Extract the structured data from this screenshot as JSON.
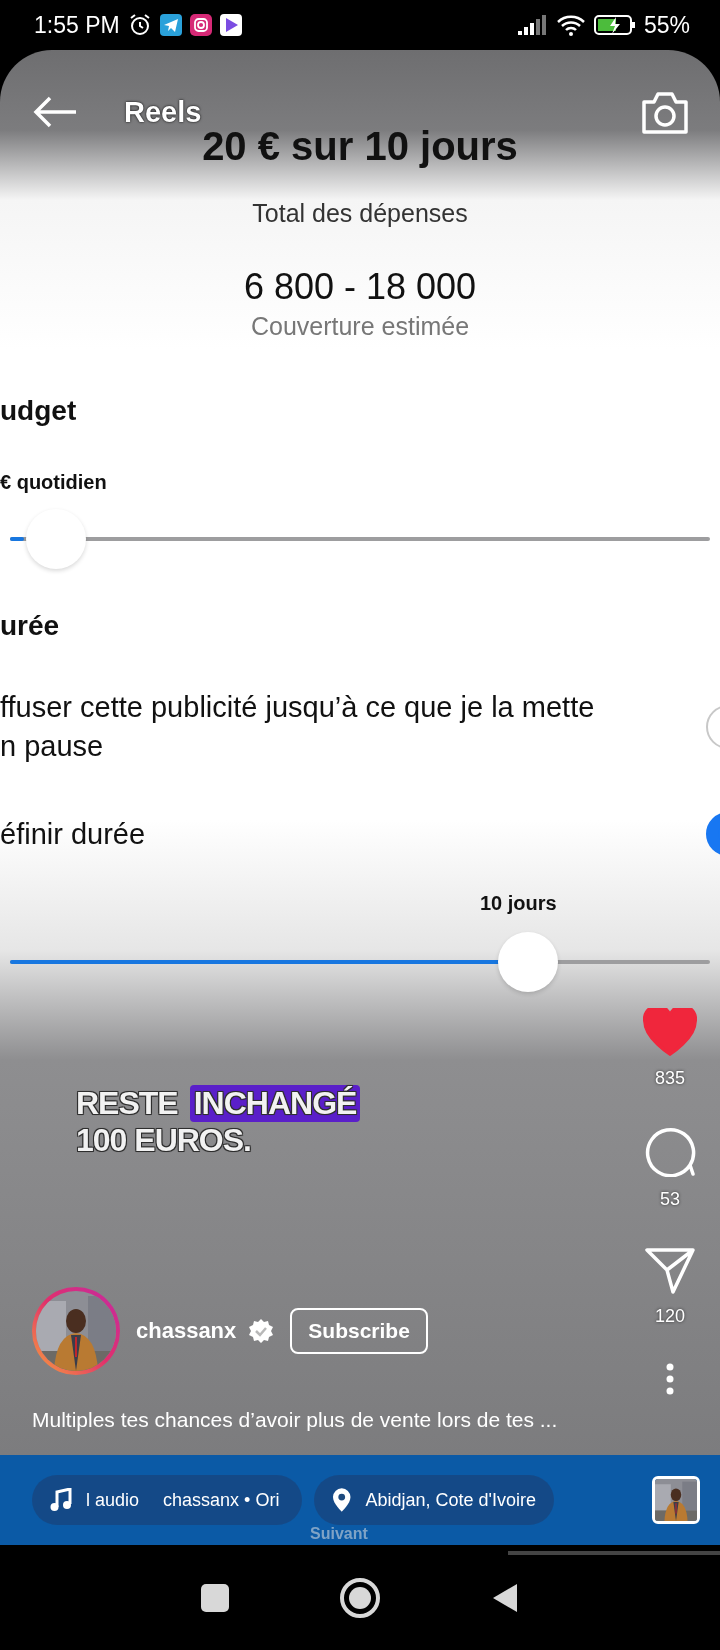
{
  "status_bar": {
    "time": "1:55 PM",
    "battery": "55%"
  },
  "header": {
    "title": "Reels"
  },
  "video": {
    "title": "20 € sur 10 jours",
    "spend_label": "Total des dépenses",
    "reach": "6 800 - 18 000",
    "reach_label": "Couverture estimée",
    "budget_heading": "udget",
    "budget_slider": {
      "label": "€ quotidien",
      "level": 0.02
    },
    "duration_heading": "urée",
    "options": [
      {
        "lines": [
          "ffuser cette publicité jusqu’à ce que je la mette",
          "n pause"
        ],
        "selected": false
      },
      {
        "lines": [
          "éfinir durée"
        ],
        "selected": true
      }
    ],
    "duration_slider": {
      "label": "10 jours",
      "level": 0.74
    },
    "next_button": "Suivant"
  },
  "caption": [
    [
      {
        "text": "RESTE",
        "highlight": false
      },
      {
        "text": "INCHANGÉ",
        "highlight": true
      }
    ],
    [
      {
        "text": "100 EUROS.",
        "highlight": false
      }
    ]
  ],
  "actions": {
    "likes": "835",
    "liked": true,
    "comments": "53",
    "shares": "120"
  },
  "author": {
    "name": "chassanx",
    "verified": true,
    "subscribe": "Subscribe"
  },
  "description": "Multiples tes chances d’avoir plus de vente lors de tes ...",
  "audio": {
    "label": "l audio",
    "track": "chassanx • Ori"
  },
  "location": "Abidjan, Cote d'Ivoire"
}
